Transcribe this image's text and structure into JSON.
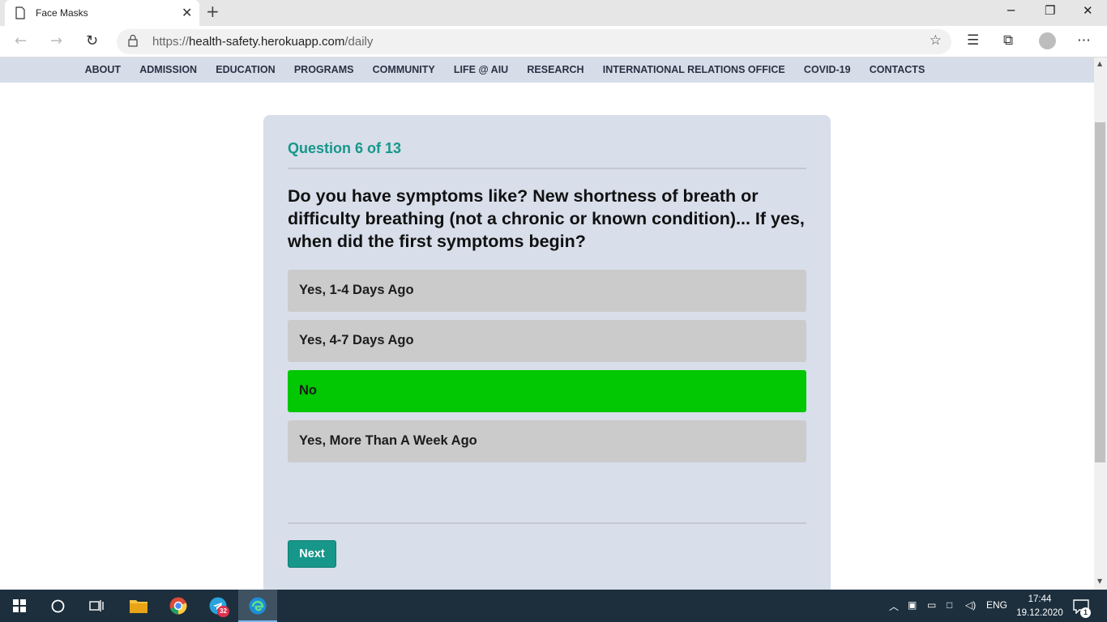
{
  "browser": {
    "tab_title": "Face Masks",
    "url_prefix": "https://",
    "url_domain": "health-safety.herokuapp.com",
    "url_path": "/daily"
  },
  "site_nav": {
    "items": [
      "ABOUT",
      "ADMISSION",
      "EDUCATION",
      "PROGRAMS",
      "COMMUNITY",
      "LIFE @ AIU",
      "RESEARCH",
      "INTERNATIONAL RELATIONS OFFICE",
      "COVID-19",
      "CONTACTS"
    ]
  },
  "quiz": {
    "progress_label": "Question 6 of 13",
    "question": "Do you have symptoms like? New shortness of breath or difficulty breathing (not a chronic or known condition)... If yes, when did the first symptoms begin?",
    "options": [
      {
        "label": "Yes, 1-4 Days Ago",
        "selected": false
      },
      {
        "label": "Yes, 4-7 Days Ago",
        "selected": false
      },
      {
        "label": "No",
        "selected": true
      },
      {
        "label": "Yes, More Than A Week Ago",
        "selected": false
      }
    ],
    "next_label": "Next",
    "answer_dots": [
      "#00c800",
      "#ff0000",
      "#ffff40",
      "#ffff40",
      "#00c800",
      "#00c800",
      "#c8c8c8",
      "#c8c8c8",
      "#c8c8c8",
      "#c8c8c8",
      "#c8c8c8",
      "#c8c8c8",
      "#c8c8c8"
    ]
  },
  "taskbar": {
    "telegram_badge": "32",
    "language": "ENG",
    "time": "17:44",
    "date": "19.12.2020",
    "notification_count": "1"
  }
}
